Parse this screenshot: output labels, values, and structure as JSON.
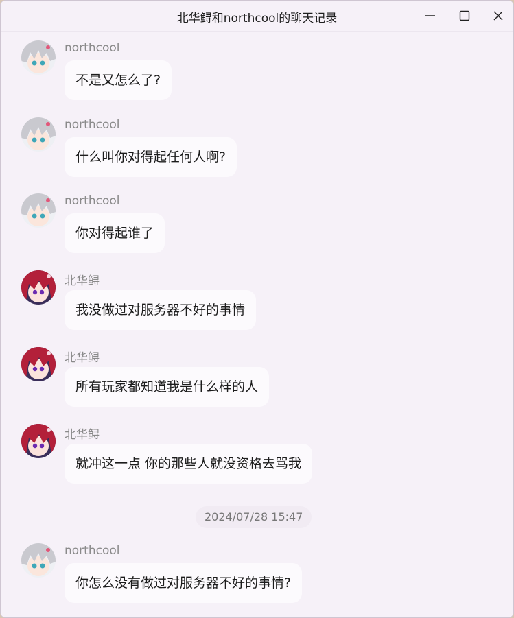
{
  "window": {
    "title": "北华鲟和northcool的聊天记录"
  },
  "messages": [
    {
      "sender": "northcool",
      "avatar": "northcool-avatar",
      "text": "不是又怎么了?"
    },
    {
      "sender": "northcool",
      "avatar": "northcool-avatar",
      "text": "什么叫你对得起任何人啊?"
    },
    {
      "sender": "northcool",
      "avatar": "northcool-avatar",
      "text": "你对得起谁了"
    },
    {
      "sender": "北华鲟",
      "avatar": "beihuaxun-avatar",
      "text": "我没做过对服务器不好的事情"
    },
    {
      "sender": "北华鲟",
      "avatar": "beihuaxun-avatar",
      "text": "所有玩家都知道我是什么样的人"
    },
    {
      "sender": "北华鲟",
      "avatar": "beihuaxun-avatar",
      "text": "就冲这一点 你的那些人就没资格去骂我"
    },
    {
      "sender": "northcool",
      "avatar": "northcool-avatar",
      "text": "你怎么没有做过对服务器不好的事情?"
    }
  ],
  "timestamp": "2024/07/28 15:47",
  "colors": {
    "window_bg": "#f6f1f8",
    "bubble_bg": "#fcfafd",
    "sender_text": "#8a8a8a",
    "northcool_hair": "#c9c9cf",
    "beihuaxun_hair": "#b3203a"
  }
}
